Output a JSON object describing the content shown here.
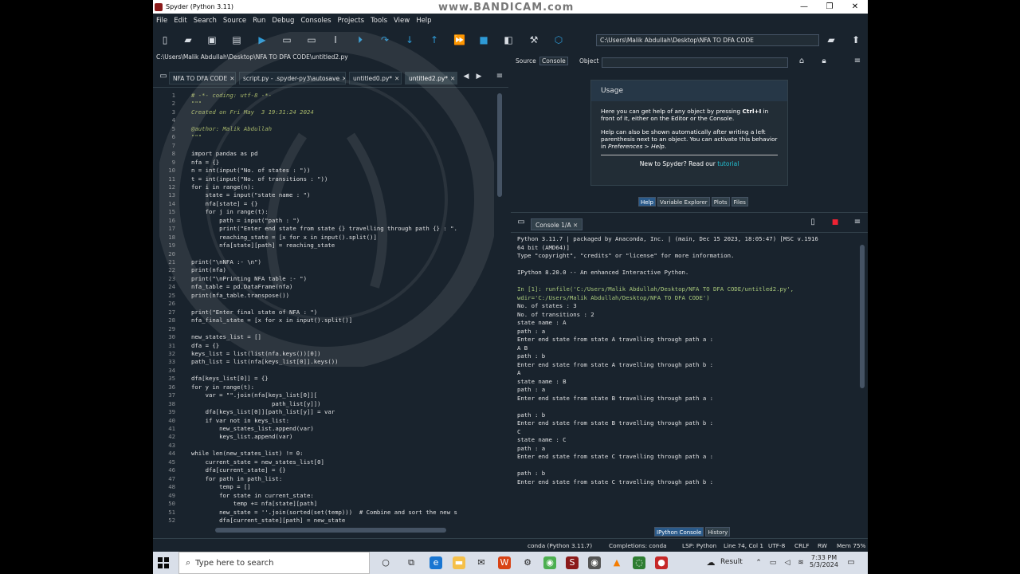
{
  "window": {
    "title": "Spyder (Python 3.11)",
    "watermark": "www.BANDICAM.com",
    "minimize": "—",
    "maximize": "❐",
    "close": "✕"
  },
  "menu": [
    "File",
    "Edit",
    "Search",
    "Source",
    "Run",
    "Debug",
    "Consoles",
    "Projects",
    "Tools",
    "View",
    "Help"
  ],
  "toolbar": {
    "working_dir": "C:\\Users\\Malik Abdullah\\Desktop\\NFA TO DFA CODE"
  },
  "editor": {
    "file_path": "C:\\Users\\Malik Abdullah\\Desktop\\NFA TO DFA CODE\\untitled2.py",
    "tabs": [
      {
        "label": "NFA TO DFA CODE",
        "active": false
      },
      {
        "label": "script.py - .spyder-py3\\autosave",
        "active": false
      },
      {
        "label": "untitled0.py*",
        "active": false
      },
      {
        "label": "untitled2.py*",
        "active": true
      }
    ],
    "line_numbers": [
      "1",
      "2",
      "3",
      "4",
      "5",
      "6",
      "7",
      "8",
      "9",
      "10",
      "11",
      "12",
      "13",
      "14",
      "15",
      "16",
      "17",
      "18",
      "19",
      "20",
      "21",
      "22",
      "23",
      "24",
      "25",
      "26",
      "27",
      "28",
      "29",
      "30",
      "31",
      "32",
      "33",
      "34",
      "35",
      "36",
      "37",
      "38",
      "39",
      "40",
      "41",
      "42",
      "43",
      "44",
      "45",
      "46",
      "47",
      "48",
      "49",
      "50",
      "51",
      "52"
    ],
    "lines": [
      "# -*- coding: utf-8 -*-",
      "\"\"\"",
      "Created on Fri May  3 19:31:24 2024",
      "",
      "@author: Malik Abdullah",
      "\"\"\"",
      "",
      "import pandas as pd",
      "nfa = {}",
      "n = int(input(\"No. of states : \"))",
      "t = int(input(\"No. of transitions : \"))",
      "for i in range(n):",
      "    state = input(\"state name : \")",
      "    nfa[state] = {}",
      "    for j in range(t):",
      "        path = input(\"path : \")",
      "        print(\"Enter end state from state {} travelling through path {} : \".",
      "        reaching_state = [x for x in input().split()]",
      "        nfa[state][path] = reaching_state",
      "",
      "print(\"\\nNFA :- \\n\")",
      "print(nfa)",
      "print(\"\\nPrinting NFA table :- \")",
      "nfa_table = pd.DataFrame(nfa)",
      "print(nfa_table.transpose())",
      "",
      "print(\"Enter final state of NFA : \")",
      "nfa_final_state = [x for x in input().split()]",
      "",
      "new_states_list = []",
      "dfa = {}",
      "keys_list = list(list(nfa.keys())[0])",
      "path_list = list(nfa[keys_list[0]].keys())",
      "",
      "dfa[keys_list[0]] = {}",
      "for y in range(t):",
      "    var = \"\".join(nfa[keys_list[0]][",
      "                       path_list[y]])",
      "    dfa[keys_list[0]][path_list[y]] = var",
      "    if var not in keys_list:",
      "        new_states_list.append(var)",
      "        keys_list.append(var)",
      "",
      "while len(new_states_list) != 0:",
      "    current_state = new_states_list[0]",
      "    dfa[current_state] = {}",
      "    for path in path_list:",
      "        temp = []",
      "        for state in current_state:",
      "            temp += nfa[state][path]",
      "        new_state = ''.join(sorted(set(temp)))  # Combine and sort the new s",
      "        dfa[current_state][path] = new_state"
    ]
  },
  "help": {
    "source_label": "Source",
    "source_value": "Console",
    "object_label": "Object",
    "usage_title": "Usage",
    "usage_p1a": "Here you can get help of any object by pressing ",
    "usage_p1b": "Ctrl+I",
    "usage_p1c": " in front of it, either on the Editor or the Console.",
    "usage_p2a": "Help can also be shown automatically after writing a left parenthesis next to an object. You can activate this behavior in ",
    "usage_p2b": "Preferences > Help",
    "usage_p2c": ".",
    "new_to": "New to Spyder? Read our ",
    "tutorial": "tutorial",
    "panel_tabs": [
      "Help",
      "Variable Explorer",
      "Plots",
      "Files"
    ]
  },
  "console": {
    "tab_label": "Console 1/A",
    "lines": [
      {
        "t": "Python 3.11.7 | packaged by Anaconda, Inc. | (main, Dec 15 2023, 18:05:47) [MSC v.1916",
        "c": ""
      },
      {
        "t": "64 bit (AMD64)]",
        "c": ""
      },
      {
        "t": "Type \"copyright\", \"credits\" or \"license\" for more information.",
        "c": ""
      },
      {
        "t": "",
        "c": ""
      },
      {
        "t": "IPython 8.20.0 -- An enhanced Interactive Python.",
        "c": ""
      },
      {
        "t": "",
        "c": ""
      },
      {
        "t": "In [1]: runfile('C:/Users/Malik Abdullah/Desktop/NFA TO DFA CODE/untitled2.py',",
        "c": "in"
      },
      {
        "t": "wdir='C:/Users/Malik Abdullah/Desktop/NFA TO DFA CODE')",
        "c": "in"
      },
      {
        "t": "No. of states : 3",
        "c": ""
      },
      {
        "t": "No. of transitions : 2",
        "c": ""
      },
      {
        "t": "state name : A",
        "c": ""
      },
      {
        "t": "path : a",
        "c": ""
      },
      {
        "t": "Enter end state from state A travelling through path a :",
        "c": ""
      },
      {
        "t": "A B",
        "c": ""
      },
      {
        "t": "path : b",
        "c": ""
      },
      {
        "t": "Enter end state from state A travelling through path b :",
        "c": ""
      },
      {
        "t": "A",
        "c": ""
      },
      {
        "t": "state name : B",
        "c": ""
      },
      {
        "t": "path : a",
        "c": ""
      },
      {
        "t": "Enter end state from state B travelling through path a :",
        "c": ""
      },
      {
        "t": "",
        "c": ""
      },
      {
        "t": "path : b",
        "c": ""
      },
      {
        "t": "Enter end state from state B travelling through path b :",
        "c": ""
      },
      {
        "t": "C",
        "c": ""
      },
      {
        "t": "state name : C",
        "c": ""
      },
      {
        "t": "path : a",
        "c": ""
      },
      {
        "t": "Enter end state from state C travelling through path a :",
        "c": ""
      },
      {
        "t": "",
        "c": ""
      },
      {
        "t": "path : b",
        "c": ""
      },
      {
        "t": "Enter end state from state C travelling through path b :",
        "c": ""
      }
    ],
    "bottom_tabs": [
      "IPython Console",
      "History"
    ]
  },
  "statusbar": {
    "env": "conda (Python 3.11.7)",
    "completions": "Completions: conda",
    "lsp": "LSP: Python",
    "position": "Line 74, Col 1",
    "encoding": "UTF-8",
    "eol": "CRLF",
    "rw": "RW",
    "mem": "Mem 75%"
  },
  "taskbar": {
    "search_placeholder": "Type here to search",
    "result_label": "Result",
    "time": "7:33 PM",
    "date": "5/3/2024"
  },
  "colors": {
    "background": "#19232d",
    "accent": "#2e9ad6",
    "comment": "#a8b86a"
  }
}
